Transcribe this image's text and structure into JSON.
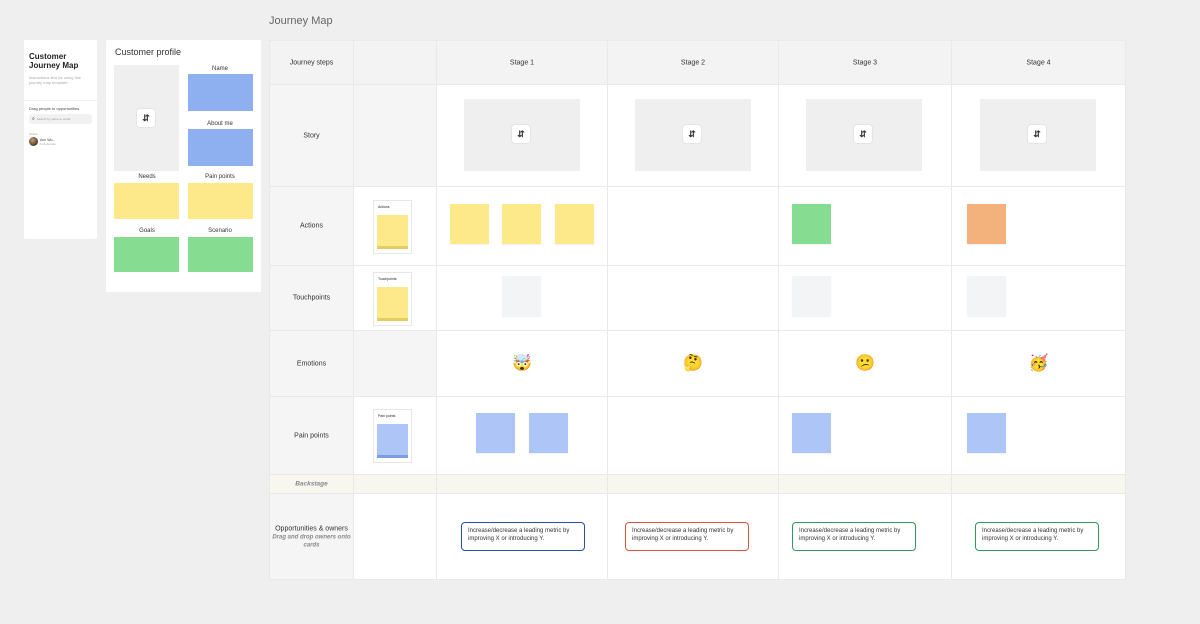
{
  "info_panel": {
    "title": "Customer Journey Map",
    "description": "Instructions text for using this journey map template",
    "drag_label": "Drag people to opportunities",
    "search_placeholder": "Search by name or email",
    "people_label": "Online",
    "person_name": "Ann Wu...",
    "person_sub": "Collaborator"
  },
  "profile": {
    "title": "Customer profile",
    "fields": {
      "name": "Name",
      "about": "About me",
      "needs": "Needs",
      "pain_points": "Pain points",
      "goals": "Goals",
      "scenario": "Scenario"
    },
    "colors": {
      "name": "#8fb0f0",
      "about": "#8fb0f0",
      "needs": "#fde88a",
      "pain": "#fde88a",
      "goals": "#86dd92",
      "scenario": "#86dd92"
    }
  },
  "journey": {
    "title": "Journey Map",
    "header_label": "Journey steps",
    "stages": [
      "Stage 1",
      "Stage 2",
      "Stage 3",
      "Stage 4"
    ],
    "rows": {
      "story": "Story",
      "actions": "Actions",
      "touchpoints": "Touchpoints",
      "emotions": "Emotions",
      "pain_points": "Pain points",
      "backstage": "Backstage",
      "opportunities": "Opportunities & owners",
      "opportunities_hint": "Drag and drop owners onto cards"
    },
    "stacks": {
      "actions": "Actions",
      "touchpoints": "Touchpoints",
      "pain_points": "Pain points"
    },
    "emotions": [
      "🤯",
      "🤔",
      "😕",
      "🥳"
    ],
    "swap_icon": "⇵",
    "opportunity_text": "Increase/decrease a leading metric by improving X or introducing Y.",
    "opportunity_colors": [
      "#2b4fa3",
      "#e0533a",
      "#2f9a5c",
      "#2f9a5c"
    ]
  }
}
